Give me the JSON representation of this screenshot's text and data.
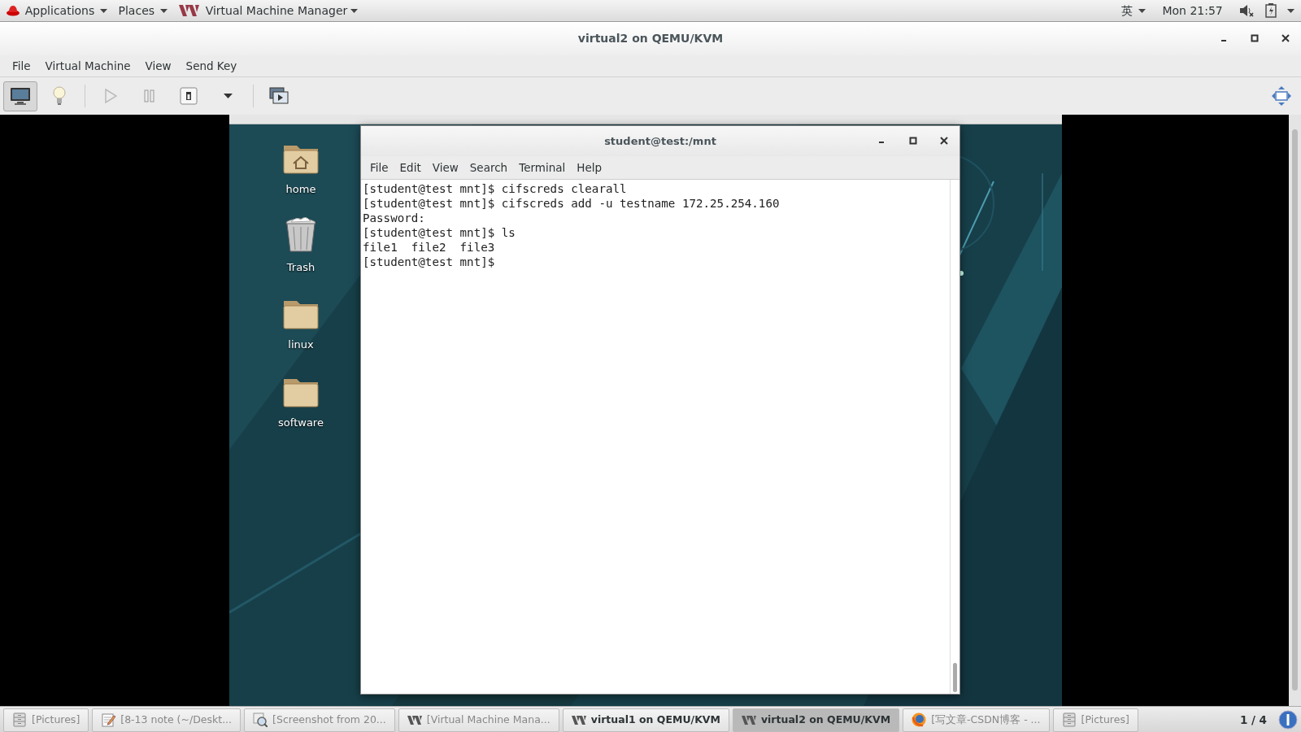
{
  "top_bar": {
    "applications": "Applications",
    "places": "Places",
    "app_menu": "Virtual Machine Manager",
    "input_method": "英",
    "clock": "Mon 21:57"
  },
  "window": {
    "title": "virtual2 on QEMU/KVM",
    "menu": [
      "File",
      "Virtual Machine",
      "View",
      "Send Key"
    ],
    "toolbar": [
      {
        "kind": "console",
        "selected": true
      },
      {
        "kind": "details",
        "selected": false
      },
      {
        "kind": "run",
        "selected": false
      },
      {
        "kind": "pause",
        "selected": false
      },
      {
        "kind": "power",
        "selected": false
      },
      {
        "kind": "dropdown",
        "selected": false
      },
      {
        "kind": "snapshots",
        "selected": false
      }
    ]
  },
  "guest": {
    "desktop_icons": [
      {
        "kind": "home",
        "label": "home"
      },
      {
        "kind": "trash",
        "label": "Trash"
      },
      {
        "kind": "folder",
        "label": "linux"
      },
      {
        "kind": "folder",
        "label": "software"
      }
    ],
    "terminal": {
      "title": "student@test:/mnt",
      "menu": [
        "File",
        "Edit",
        "View",
        "Search",
        "Terminal",
        "Help"
      ],
      "lines": [
        "[student@test mnt]$ cifscreds clearall",
        "[student@test mnt]$ cifscreds add -u testname 172.25.254.160",
        "Password:",
        "[student@test mnt]$ ls",
        "file1  file2  file3",
        "[student@test mnt]$"
      ]
    }
  },
  "taskbar": {
    "items": [
      {
        "kind": "cabinet",
        "label": "[Pictures]",
        "selected": false
      },
      {
        "kind": "notepad",
        "label": "[8-13 note (~/Deskt...",
        "selected": false
      },
      {
        "kind": "screenshot",
        "label": "[Screenshot from 20...",
        "selected": false
      },
      {
        "kind": "vmm",
        "label": "[Virtual Machine Mana...",
        "selected": false
      },
      {
        "kind": "vmm",
        "label": "virtual1 on QEMU/KVM",
        "selected": false
      },
      {
        "kind": "vmm",
        "label": "virtual2 on QEMU/KVM",
        "selected": true
      },
      {
        "kind": "browser",
        "label": "[写文章-CSDN博客 - ...",
        "selected": false
      },
      {
        "kind": "cabinet",
        "label": "[Pictures]",
        "selected": false
      }
    ],
    "pager": "1 / 4"
  }
}
